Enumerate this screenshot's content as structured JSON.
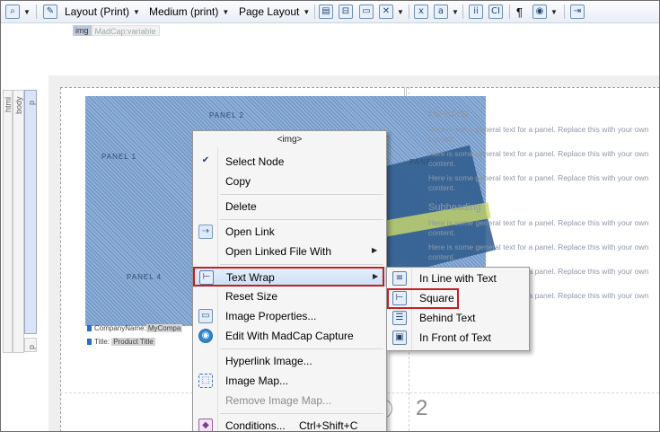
{
  "toolbar": {
    "layout_print": "Layout (Print)",
    "medium_print": "Medium (print)",
    "page_layout": "Page Layout"
  },
  "tags": {
    "img": "img",
    "variable": "MadCap:variable"
  },
  "structure": {
    "html": "html",
    "body": "body",
    "p": "p",
    "p2": "p"
  },
  "page": {
    "panels": [
      "PANEL 2",
      "PANEL 1",
      "PANEL 4",
      "PANEL"
    ],
    "heading": "Heading",
    "subheading": "Subheading",
    "paragraph": "Here is some general text for a panel. Replace this with your own content.",
    "company_label": "CompanyName:",
    "company_value": "MyCompa",
    "title_label": "Title:",
    "title_value": "Product Title",
    "page_number": "2"
  },
  "context_menu": {
    "title": "<img>",
    "items": {
      "select_node": "Select Node",
      "copy": "Copy",
      "delete": "Delete",
      "open_link": "Open Link",
      "open_linked_file_with": "Open Linked File With",
      "text_wrap": "Text Wrap",
      "reset_size": "Reset Size",
      "image_properties": "Image Properties...",
      "edit_madcap_capture": "Edit With MadCap Capture",
      "hyperlink_image": "Hyperlink Image...",
      "image_map": "Image Map...",
      "remove_image_map": "Remove Image Map...",
      "conditions": "Conditions...",
      "conditions_shortcut": "Ctrl+Shift+C"
    }
  },
  "text_wrap_menu": {
    "items": [
      "In Line with Text",
      "Square",
      "Behind Text",
      "In Front of Text"
    ],
    "selected": "Square"
  },
  "colors": {
    "highlight_border": "#c22021",
    "menu_background": "#f5f5f5"
  }
}
